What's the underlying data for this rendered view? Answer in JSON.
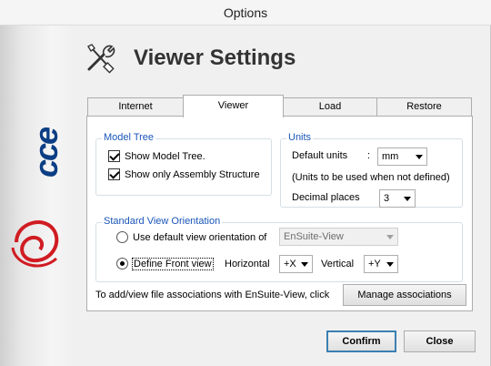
{
  "window": {
    "title": "Options"
  },
  "header": {
    "title": "Viewer Settings",
    "icon": "tools-icon"
  },
  "brand": {
    "text": "cce"
  },
  "tabs": [
    {
      "label": "Internet",
      "active": false
    },
    {
      "label": "Viewer",
      "active": true
    },
    {
      "label": "Load",
      "active": false
    },
    {
      "label": "Restore",
      "active": false
    }
  ],
  "model_tree": {
    "title": "Model Tree",
    "show_model_tree": {
      "label": "Show Model Tree.",
      "checked": true
    },
    "show_assembly": {
      "label": "Show only Assembly Structure",
      "checked": true
    }
  },
  "units": {
    "title": "Units",
    "default_units_label": "Default units",
    "colon": ":",
    "default_units_value": "mm",
    "note": "(Units to be used when not defined)",
    "decimal_label": "Decimal places",
    "decimal_value": "3"
  },
  "orientation": {
    "title": "Standard View Orientation",
    "use_default_label": "Use default view orientation of",
    "use_default_selected": false,
    "default_view_value": "EnSuite-View",
    "define_front_label": "Define Front view",
    "define_front_selected": true,
    "horizontal_label": "Horizontal",
    "horizontal_value": "+X",
    "vertical_label": "Vertical",
    "vertical_value": "+Y"
  },
  "associations": {
    "text": "To add/view file associations with EnSuite-View, click",
    "button_label": "Manage associations"
  },
  "footer": {
    "confirm_label": "Confirm",
    "close_label": "Close"
  },
  "colors": {
    "group_title": "#1a55b8",
    "brand": "#0c3e84",
    "brand_swirl": "#d01c22",
    "default_button_border": "#3c7fb1"
  }
}
